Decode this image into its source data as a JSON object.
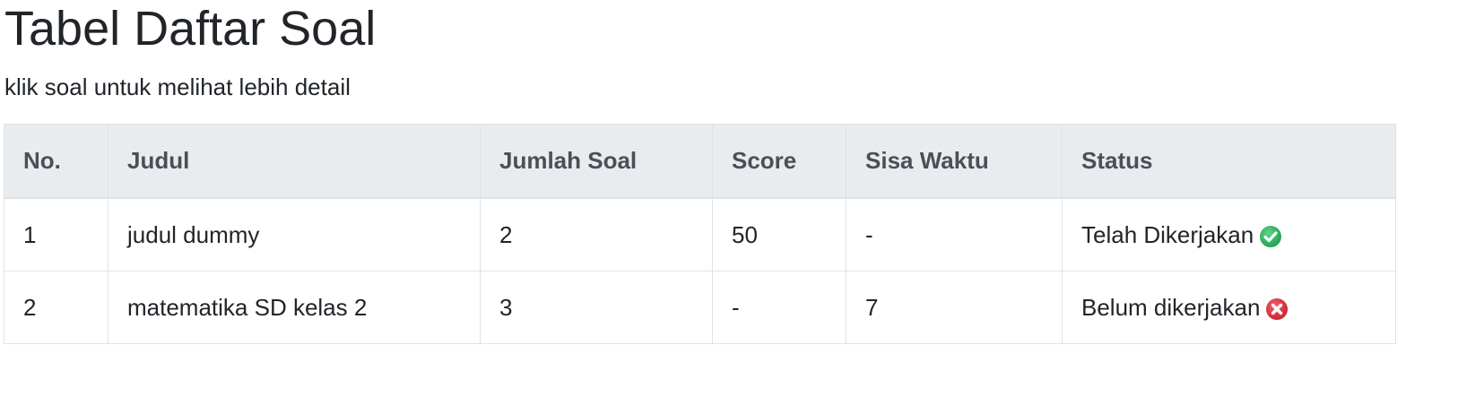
{
  "page": {
    "title": "Tabel Daftar Soal",
    "subtitle": "klik soal untuk melihat lebih detail"
  },
  "table": {
    "headers": [
      "No.",
      "Judul",
      "Jumlah Soal",
      "Score",
      "Sisa Waktu",
      "Status"
    ],
    "rows": [
      {
        "no": "1",
        "judul": "judul dummy",
        "jumlah_soal": "2",
        "score": "50",
        "sisa_waktu": "-",
        "status": "Telah Dikerjakan",
        "status_icon": "check-circle-icon",
        "status_color": "#28a745"
      },
      {
        "no": "2",
        "judul": "matematika SD kelas 2",
        "jumlah_soal": "3",
        "score": "-",
        "sisa_waktu": "7",
        "status": "Belum dikerjakan",
        "status_icon": "x-circle-icon",
        "status_color": "#dc3545"
      }
    ]
  }
}
